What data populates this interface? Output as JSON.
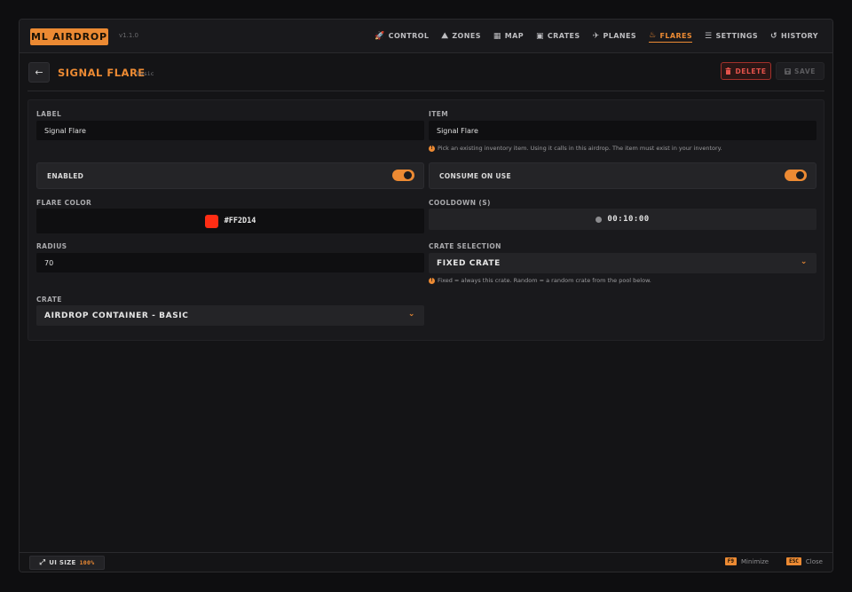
{
  "app": {
    "brand": "ML AIRDROP",
    "version": "v1.1.0"
  },
  "nav": [
    {
      "label": "CONTROL",
      "icon": "rocket-icon",
      "glyph": "🚀",
      "active": false
    },
    {
      "label": "ZONES",
      "icon": "zones-icon",
      "glyph": "⛰",
      "active": false
    },
    {
      "label": "MAP",
      "icon": "map-icon",
      "glyph": "▦",
      "active": false
    },
    {
      "label": "CRATES",
      "icon": "crate-icon",
      "glyph": "▣",
      "active": false
    },
    {
      "label": "PLANES",
      "icon": "plane-icon",
      "glyph": "✈",
      "active": false
    },
    {
      "label": "FLARES",
      "icon": "flame-icon",
      "glyph": "♨",
      "active": true
    },
    {
      "label": "SETTINGS",
      "icon": "sliders-icon",
      "glyph": "☰",
      "active": false
    },
    {
      "label": "HISTORY",
      "icon": "history-icon",
      "glyph": "↺",
      "active": false
    }
  ],
  "header": {
    "back": "←",
    "title": "SIGNAL FLARE",
    "subtitle": "basic",
    "delete_label": "DELETE",
    "save_label": "SAVE"
  },
  "form": {
    "label": {
      "label": "LABEL",
      "value": "Signal Flare"
    },
    "item": {
      "label": "ITEM",
      "value": "Signal Flare",
      "hint": "Pick an existing inventory item. Using it calls in this airdrop. The item must exist in your inventory."
    },
    "enabled": {
      "label": "ENABLED",
      "on": true
    },
    "consume": {
      "label": "CONSUME ON USE",
      "on": true
    },
    "flare_color": {
      "label": "FLARE COLOR",
      "value": "#FF2D14",
      "swatch": "#FF2D14"
    },
    "cooldown": {
      "label": "COOLDOWN (S)",
      "value": "00:10:00"
    },
    "radius": {
      "label": "RADIUS",
      "value": "70"
    },
    "crate_selection": {
      "label": "CRATE SELECTION",
      "value": "FIXED CRATE",
      "hint": "Fixed = always this crate. Random = a random crate from the pool below."
    },
    "crate": {
      "label": "CRATE",
      "value": "AIRDROP CONTAINER - BASIC"
    }
  },
  "footer": {
    "ui_size_label": "UI SIZE",
    "ui_size_value": "100%",
    "minimize_key": "F9",
    "minimize_label": "Minimize",
    "close_key": "ESC",
    "close_label": "Close"
  },
  "colors": {
    "accent": "#ec8a33",
    "danger": "#e5534b",
    "background": "#141416"
  }
}
